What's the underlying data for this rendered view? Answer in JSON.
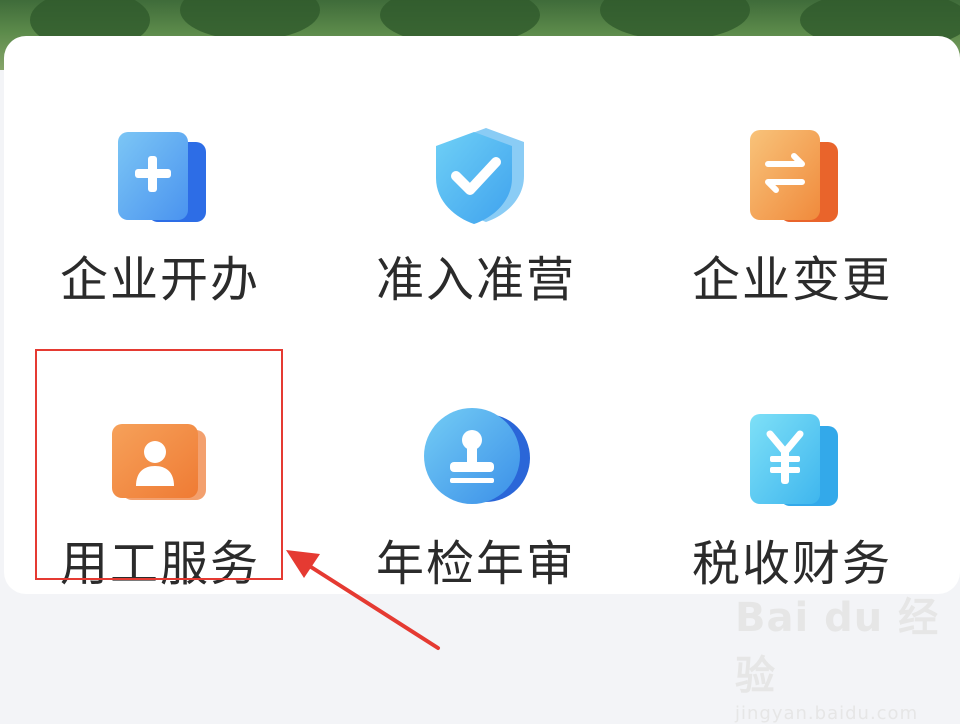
{
  "services": {
    "row1": [
      {
        "label": "企业开办",
        "icon": "add-document-icon"
      },
      {
        "label": "准入准营",
        "icon": "shield-check-icon"
      },
      {
        "label": "企业变更",
        "icon": "exchange-document-icon"
      }
    ],
    "row2": [
      {
        "label": "用工服务",
        "icon": "person-card-icon"
      },
      {
        "label": "年检年审",
        "icon": "stamp-icon"
      },
      {
        "label": "税收财务",
        "icon": "yuan-document-icon"
      }
    ]
  },
  "watermark": {
    "brand": "Bai du 经验",
    "url": "jingyan.baidu.com"
  },
  "colors": {
    "highlight": "#e53a32",
    "blue": "#4aa3f0",
    "orange": "#f08a3c"
  }
}
